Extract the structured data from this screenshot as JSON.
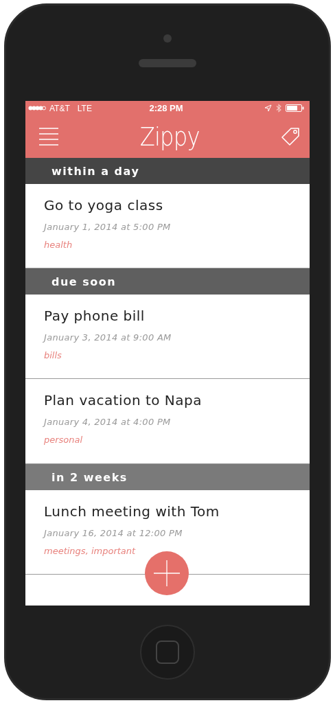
{
  "status_bar": {
    "carrier": "AT&T",
    "network": "LTE",
    "time": "2:28 PM"
  },
  "nav_bar": {
    "title": "Zippy"
  },
  "sections": [
    {
      "title": "within a day",
      "color": "#454545",
      "tasks": [
        {
          "title": "Go to yoga class",
          "due": "January 1, 2014 at 5:00 PM",
          "tags": "health"
        }
      ]
    },
    {
      "title": "due soon",
      "color": "#5f5f5f",
      "tasks": [
        {
          "title": "Pay phone bill",
          "due": "January 3, 2014 at 9:00 AM",
          "tags": "bills"
        },
        {
          "title": "Plan vacation to Napa",
          "due": "January 4, 2014 at 4:00 PM",
          "tags": "personal"
        }
      ]
    },
    {
      "title": "in 2 weeks",
      "color": "#7a7a7a",
      "tasks": [
        {
          "title": "Lunch meeting with Tom",
          "due": "January 16, 2014 at 12:00 PM",
          "tags": "meetings, important"
        }
      ]
    }
  ]
}
